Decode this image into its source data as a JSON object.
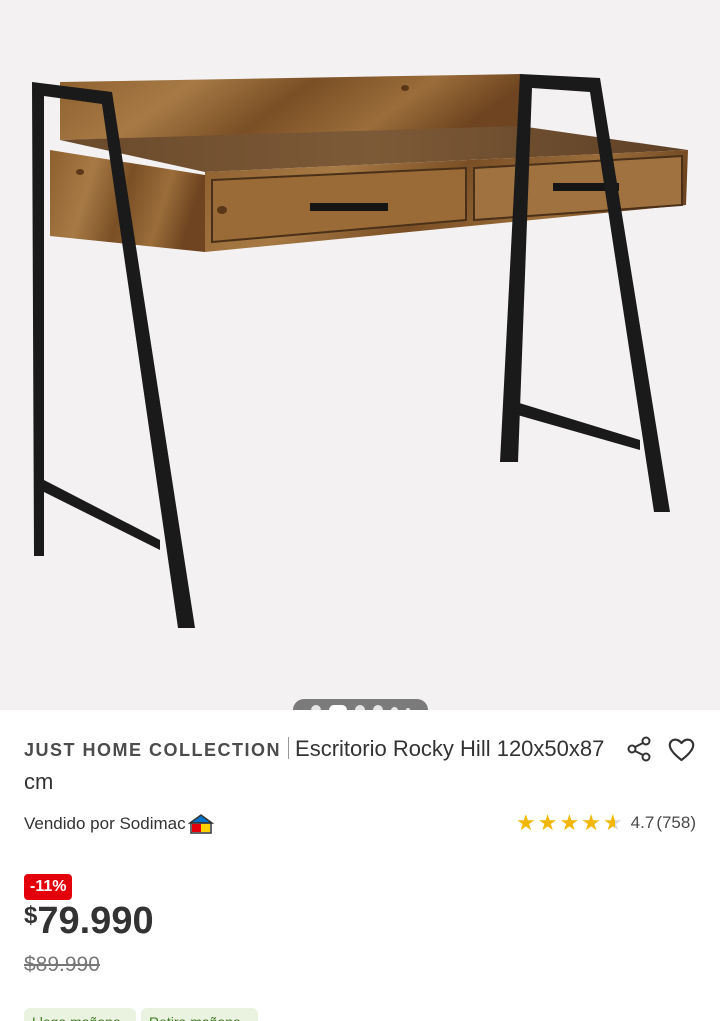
{
  "gallery": {
    "image_alt": "Escritorio Rocky Hill",
    "slides": [
      {
        "state": "inactive"
      },
      {
        "state": "active"
      },
      {
        "state": "inactive"
      },
      {
        "state": "inactive"
      },
      {
        "state": "small"
      },
      {
        "state": "tiny"
      }
    ]
  },
  "product": {
    "brand": "JUST HOME COLLECTION",
    "name": "Escritorio Rocky Hill 120x50x87 cm",
    "seller": "Vendido por Sodimac",
    "rating_value": "4.7",
    "rating_count": "(758)",
    "rating_stars": 4.7
  },
  "pricing": {
    "discount_badge": "-11%",
    "currency": "$",
    "current_price": "79.990",
    "old_price": "$89.990"
  },
  "chips": [
    "Llega mañana",
    "Retira mañana"
  ],
  "icons": {
    "share": "share-icon",
    "favorite": "heart-icon",
    "seller_logo": "sodimac-house-logo",
    "star": "star-icon"
  },
  "colors": {
    "discount": "#e3000b",
    "star": "#f2b705",
    "frame": "#1a1a1a",
    "wood": "#8a5a2b"
  }
}
